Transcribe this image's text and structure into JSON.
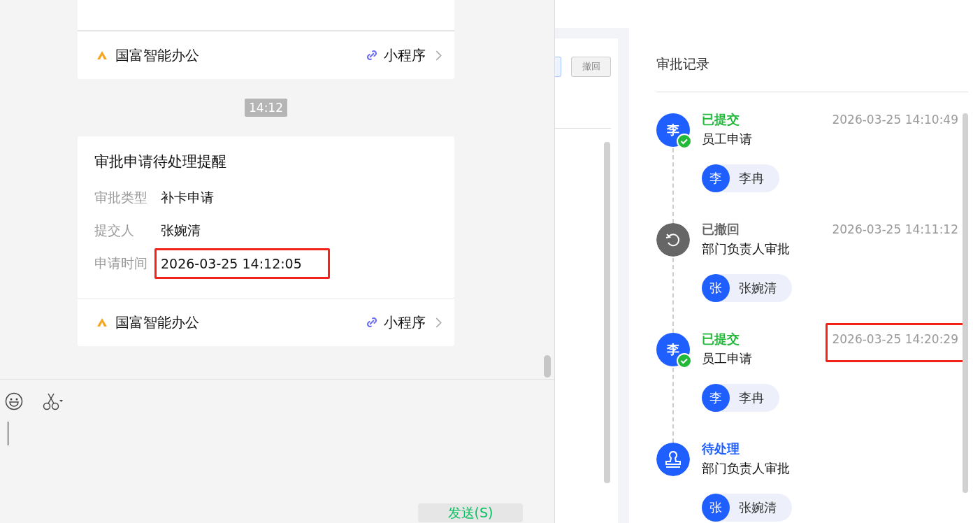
{
  "chat": {
    "top_card": {
      "app": "国富智能办公",
      "tag": "小程序"
    },
    "time": "14:12",
    "card": {
      "title": "审批申请待处理提醒",
      "fields": [
        {
          "label": "审批类型",
          "value": "补卡申请",
          "highlighted": false
        },
        {
          "label": "提交人",
          "value": "张婉清",
          "highlighted": false
        },
        {
          "label": "申请时间",
          "value": "2026-03-25 14:12:05",
          "highlighted": true
        }
      ],
      "app": "国富智能办公",
      "tag": "小程序"
    },
    "send_button": "发送(S)"
  },
  "detail": {
    "withdraw_button": "撤回"
  },
  "approval": {
    "title": "审批记录",
    "records": [
      {
        "kind": "submitted",
        "status": "已提交",
        "step": "员工申请",
        "time": "2026-03-25 14:10:49",
        "highlighted": false,
        "avatar": "李",
        "person": {
          "initial": "李",
          "name": "李冉"
        }
      },
      {
        "kind": "withdrawn",
        "status": "已撤回",
        "step": "部门负责人审批",
        "time": "2026-03-25 14:11:12",
        "highlighted": false,
        "person": {
          "initial": "张",
          "name": "张婉清"
        }
      },
      {
        "kind": "submitted",
        "status": "已提交",
        "step": "员工申请",
        "time": "2026-03-25 14:20:29",
        "highlighted": true,
        "avatar": "李",
        "person": {
          "initial": "李",
          "name": "李冉"
        }
      },
      {
        "kind": "pending",
        "status": "待处理",
        "step": "部门负责人审批",
        "person": {
          "initial": "张",
          "name": "张婉清"
        }
      }
    ]
  }
}
